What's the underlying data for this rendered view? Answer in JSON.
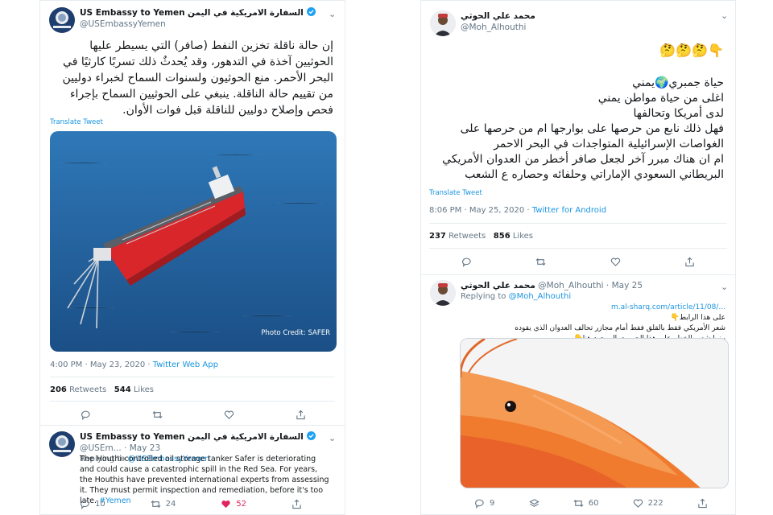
{
  "left_tweet": {
    "name": "US Embassy to Yemen",
    "name_ar": "السفارة الامريكية في اليمن",
    "handle": "@USEmbassyYemen",
    "text": "إن حالة ناقلة تخزين النفط (صافر) التي يسيطر عليها الحوثيين آخذة في التدهور، وقد يُحدثٌ ذلك تسربًا كارثيًا في البحر الأحمر. منع الحوثيون ولسنوات السماح لخبراء دوليين من تقييم حالة الناقلة.  ينبغي على الحوثيين السماح بإجراء فحص وإصلاح دوليين للناقلة قبل فوات الأوان.",
    "translate": "Translate Tweet",
    "photo_credit": "Photo Credit: SAFER",
    "time": "4:00 PM · May 23, 2020 · ",
    "source": "Twitter Web App",
    "retweets": "206",
    "retweets_label": "Retweets",
    "likes": "544",
    "likes_label": "Likes"
  },
  "left_reply": {
    "name": "US Embassy to Yemen",
    "name_ar": "السفارة الامريكية في اليمن",
    "handle_date": "@USEm... · May 23",
    "replying_label": "Replying to",
    "replying_to": "@USEmbassyYemen",
    "text": "The Houthi-controlled oil storage tanker Safer is deteriorating and could cause a catastrophic spill in the Red Sea. For years, the Houthis have prevented international experts from assessing it. They must permit inspection and remediation, before it's too late.",
    "hashtag": "#Yemen",
    "replies": "10",
    "retweets": "24",
    "likes": "52"
  },
  "right_tweet": {
    "name_ar": "محمد علي الحوثي",
    "handle": "@Moh_Alhouthi",
    "emojis": "👇🤔🤔🤔",
    "line1": "حياة جمبري🌍يمني",
    "line2": "اغلى من حياة مواطن يمني",
    "line3": "لدى أمريكا وتحالفها",
    "line4": "فهل ذلك نابع من حرصها على بوارجها ام من حرصها على الغواصات الإسرائيلية المتواجدات في البحر الاحمر",
    "line5": "ام ان هناك مبرر آخر لجعل صافر أخطر من العدوان الأمريكي البريطاني السعودي الإماراتي وحلفائه وحصاره ع الشعب",
    "translate": "Translate Tweet",
    "time": "8:06 PM · May 25, 2020 · ",
    "source": "Twitter for Android",
    "retweets": "237",
    "retweets_label": "Retweets",
    "likes": "856",
    "likes_label": "Likes"
  },
  "right_reply": {
    "name_ar": "محمد علي الحوثي",
    "handle_date": "@Moh_Alhouthi · May 25",
    "replying_label": "Replying to",
    "replying_to": "@Moh_Alhouthi",
    "link": "m.al-sharq.com/article/11/08/...",
    "line1": "على هذا الرابط👇",
    "line2": "شعر الأمريكي فقط بالقلق فقط أمام مجازر تحالف العدوان الذي يقوده",
    "line3": "بينما شعر بالخطر على هذا الجمبري الموجود هنا👇",
    "replies": "9",
    "retweets": "60",
    "likes": "222"
  },
  "icons": [
    "verified-icon",
    "chevron-down-icon",
    "reply-icon",
    "retweet-icon",
    "like-icon",
    "share-icon",
    "stack-icon"
  ],
  "colors": {
    "link": "#1b95e0",
    "liked": "#e0245e",
    "verified": "#1da1f2",
    "muted": "#657786"
  }
}
